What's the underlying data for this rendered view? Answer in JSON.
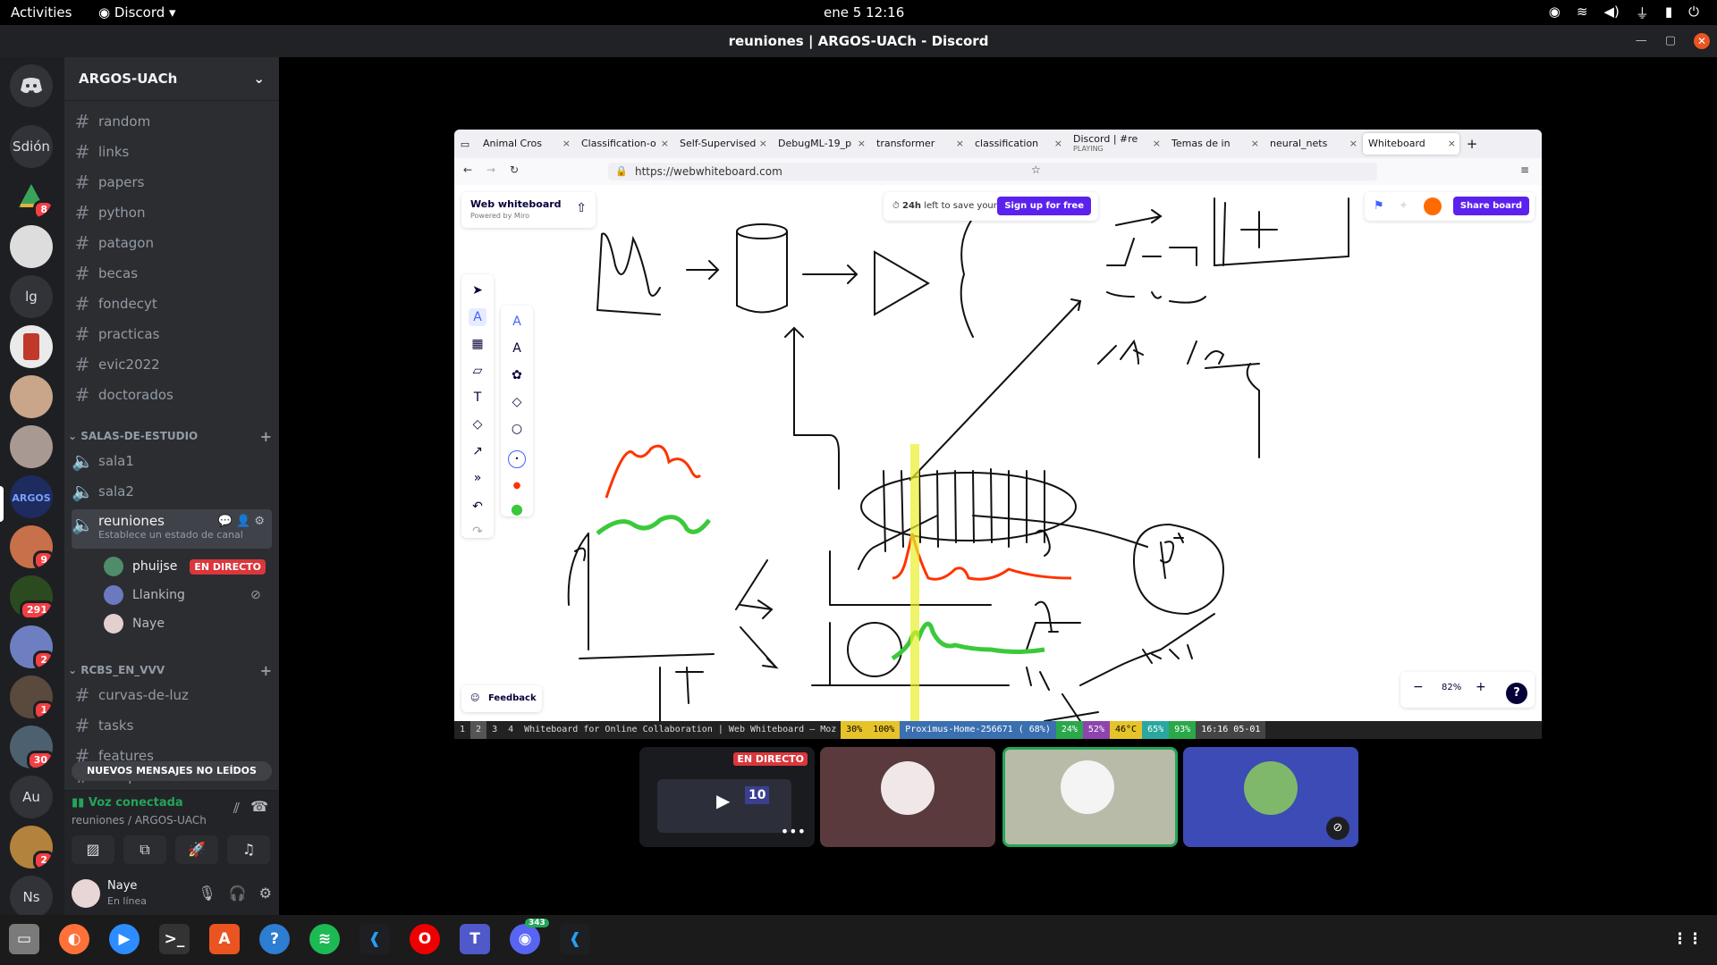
{
  "topbar": {
    "activities": "Activities",
    "app": "Discord",
    "clock": "ene 5  12:16"
  },
  "window": {
    "title": "reuniones | ARGOS-UACh - Discord"
  },
  "rail": {
    "servers": [
      {
        "label": "",
        "badge": ""
      },
      {
        "label": "Sdión",
        "badge": ""
      },
      {
        "label": "",
        "badge": "8"
      },
      {
        "label": "",
        "badge": ""
      },
      {
        "label": "lg",
        "badge": ""
      },
      {
        "label": "",
        "badge": ""
      },
      {
        "label": "",
        "badge": ""
      },
      {
        "label": "",
        "badge": ""
      },
      {
        "label": "",
        "badge": ""
      },
      {
        "label": "",
        "badge": "9"
      },
      {
        "label": "",
        "badge": "291"
      },
      {
        "label": "",
        "badge": "2"
      },
      {
        "label": "",
        "badge": "1"
      },
      {
        "label": "",
        "badge": "30"
      },
      {
        "label": "Au",
        "badge": ""
      },
      {
        "label": "",
        "badge": "2"
      },
      {
        "label": "Ns",
        "badge": ""
      }
    ]
  },
  "sidebar": {
    "server_name": "ARGOS-UACh",
    "text_channels": [
      "random",
      "links",
      "papers",
      "python",
      "patagon",
      "becas",
      "fondecyt",
      "practicas",
      "evic2022",
      "doctorados"
    ],
    "category_study": "SALAS-DE-ESTUDIO",
    "voice_channels": [
      "sala1",
      "sala2"
    ],
    "active_voice": {
      "name": "reuniones",
      "status": "Establece un estado de canal"
    },
    "voice_users": [
      {
        "name": "phuijse",
        "live": "EN DIRECTO"
      },
      {
        "name": "Llanking",
        "live": ""
      },
      {
        "name": "Naye",
        "live": ""
      }
    ],
    "category_rcbs": "RCBS_EN_VVV",
    "rcbs_channels": [
      "curvas-de-luz",
      "tasks",
      "features",
      "umap"
    ],
    "new_messages": "NUEVOS MENSAJES NO LEÍDOS"
  },
  "voice_panel": {
    "status": "Voz conectada",
    "channel": "reuniones / ARGOS-UACh"
  },
  "user_panel": {
    "name": "Naye",
    "status": "En línea"
  },
  "browser": {
    "tabs": [
      {
        "label": "Animal Cros"
      },
      {
        "label": "Classification-o"
      },
      {
        "label": "Self-Supervised"
      },
      {
        "label": "DebugML-19_p"
      },
      {
        "label": "transformer"
      },
      {
        "label": "classification"
      },
      {
        "label": "Discord | #re",
        "sub": "PLAYING"
      },
      {
        "label": "Temas de in"
      },
      {
        "label": "neural_nets"
      },
      {
        "label": "Whiteboard"
      }
    ],
    "url": "https://webwhiteboard.com"
  },
  "whiteboard": {
    "title": "Web whiteboard",
    "powered": "Powered by Miro",
    "save_hours": "24h",
    "save_text": "left to save your board.",
    "signup": "Sign up for free",
    "share": "Share board",
    "feedback": "Feedback",
    "zoom": "82%",
    "help": "?"
  },
  "i3bar": {
    "workspaces": [
      "1",
      "2",
      "3",
      "4"
    ],
    "window_title": "Whiteboard for Online Collaboration | Web Whiteboard — Moz",
    "cpu": "30%",
    "volume": "100%",
    "wifi": "Proximus-Home-256671 ( 68%)",
    "mem1": "24%",
    "mem2": "52%",
    "temp": "46°C",
    "disk": "65%",
    "battery": "93%",
    "clock": "16:16 05-01"
  },
  "tiles": {
    "live": "EN DIRECTO",
    "tile1_badge": "10"
  },
  "dock": {
    "discord_badge": "343"
  },
  "colors": {
    "accent": "#5865f2",
    "danger": "#da373c",
    "online": "#23a559",
    "miro": "#5b22ee"
  }
}
